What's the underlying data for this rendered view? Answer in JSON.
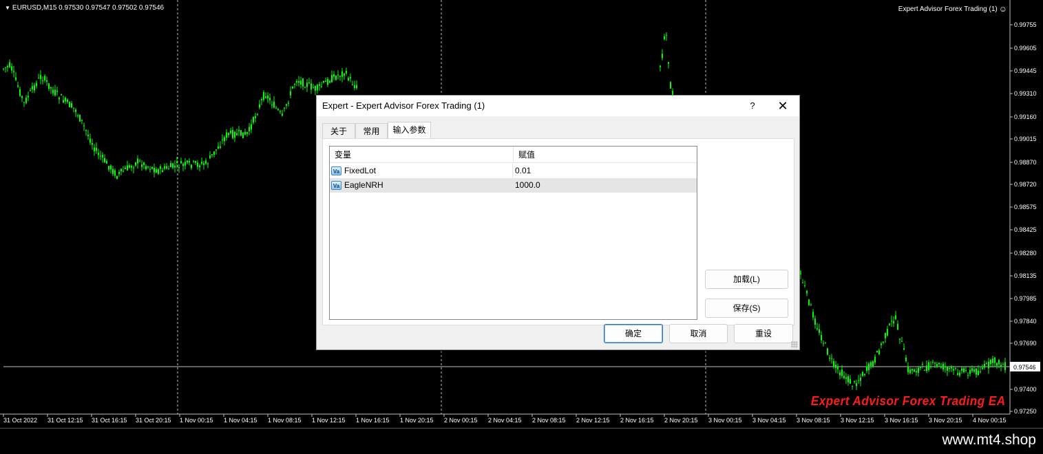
{
  "chart": {
    "symbol_info": "EURUSD,M15  0.97530 0.97547 0.97502 0.97546",
    "ea_indicator": "Expert Advisor Forex Trading (1)",
    "price_labels": [
      "0.99755",
      "0.99605",
      "0.99445",
      "0.99310",
      "0.99160",
      "0.99015",
      "0.98870",
      "0.98720",
      "0.98575",
      "0.98425",
      "0.98280",
      "0.98135",
      "0.97985",
      "0.97840",
      "0.97690",
      "0.97400",
      "0.97250"
    ],
    "current_price": "0.97546",
    "time_labels": [
      "31 Oct 2022",
      "31 Oct 12:15",
      "31 Oct 16:15",
      "31 Oct 20:15",
      "1 Nov 00:15",
      "1 Nov 04:15",
      "1 Nov 08:15",
      "1 Nov 12:15",
      "1 Nov 16:15",
      "1 Nov 20:15",
      "2 Nov 00:15",
      "2 Nov 04:15",
      "2 Nov 08:15",
      "2 Nov 12:15",
      "2 Nov 16:15",
      "2 Nov 20:15",
      "3 Nov 00:15",
      "3 Nov 04:15",
      "3 Nov 08:15",
      "3 Nov 12:15",
      "3 Nov 16:15",
      "3 Nov 20:15",
      "4 Nov 00:15"
    ],
    "watermark": "Expert Advisor Forex Trading EA",
    "candle_color": "#00ff00",
    "background_color": "#000000"
  },
  "dialog": {
    "title": "Expert - Expert Advisor Forex Trading (1)",
    "help_label": "?",
    "close_label": "✕",
    "tabs": [
      {
        "label": "关于"
      },
      {
        "label": "常用"
      },
      {
        "label": "输入参数"
      }
    ],
    "table": {
      "columns": [
        "变量",
        "赋值"
      ],
      "rows": [
        {
          "name": "FixedLot",
          "value": "0.01",
          "icon": "variable-icon"
        },
        {
          "name": "EagleNRH",
          "value": "1000.0",
          "icon": "variable-icon"
        }
      ]
    },
    "buttons": {
      "load": "加载(L)",
      "save": "保存(S)",
      "ok": "确定",
      "cancel": "取消",
      "reset": "重设"
    }
  },
  "footer": {
    "url": "www.mt4.shop"
  }
}
